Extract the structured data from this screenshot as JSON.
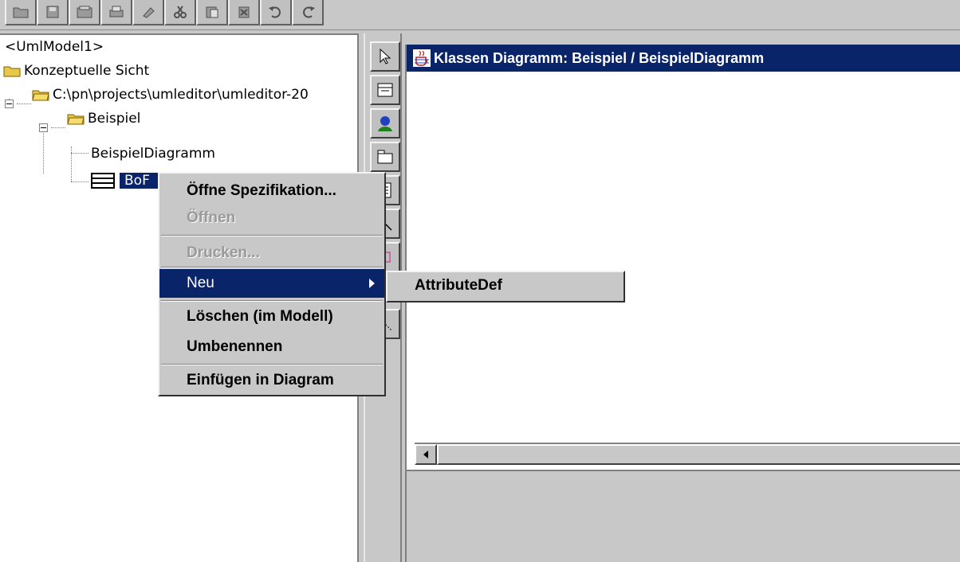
{
  "tree": {
    "root": "<UmlModel1>",
    "items": [
      {
        "label": "Konzeptuelle Sicht"
      },
      {
        "label": "C:\\pn\\projects\\umleditor\\umleditor-20"
      },
      {
        "label": "Beispiel"
      },
      {
        "label": "BeispielDiagramm"
      },
      {
        "label": "BoF"
      }
    ]
  },
  "diagram": {
    "title": "Klassen Diagramm: Beispiel / BeispielDiagramm"
  },
  "context_menu": {
    "items": [
      {
        "label": "Öffne Spezifikation...",
        "state": "enabled"
      },
      {
        "label": "Öffnen",
        "state": "disabled"
      },
      {
        "label": "Drucken...",
        "state": "disabled"
      },
      {
        "label": "Neu",
        "state": "highlighted"
      },
      {
        "label": "Löschen (im Modell)",
        "state": "enabled"
      },
      {
        "label": "Umbenennen",
        "state": "enabled"
      },
      {
        "label": "Einfügen in Diagram",
        "state": "enabled"
      }
    ]
  },
  "submenu": {
    "items": [
      {
        "label": "AttributeDef"
      }
    ]
  },
  "colors": {
    "selection": "#0a246a",
    "panel": "#c8c8c8",
    "disabled_text": "#9a9a9a"
  },
  "icons": {
    "toolbar": [
      "open-icon",
      "save-icon",
      "save-all-icon",
      "print-icon",
      "copy-icon",
      "cut-icon",
      "paste-icon",
      "delete-icon",
      "undo-icon",
      "redo-icon"
    ],
    "palette": [
      "select-arrow-icon",
      "class-icon",
      "actor-icon",
      "package-icon",
      "note-icon",
      "association-icon",
      "dependency-icon",
      "generalization-icon"
    ]
  }
}
